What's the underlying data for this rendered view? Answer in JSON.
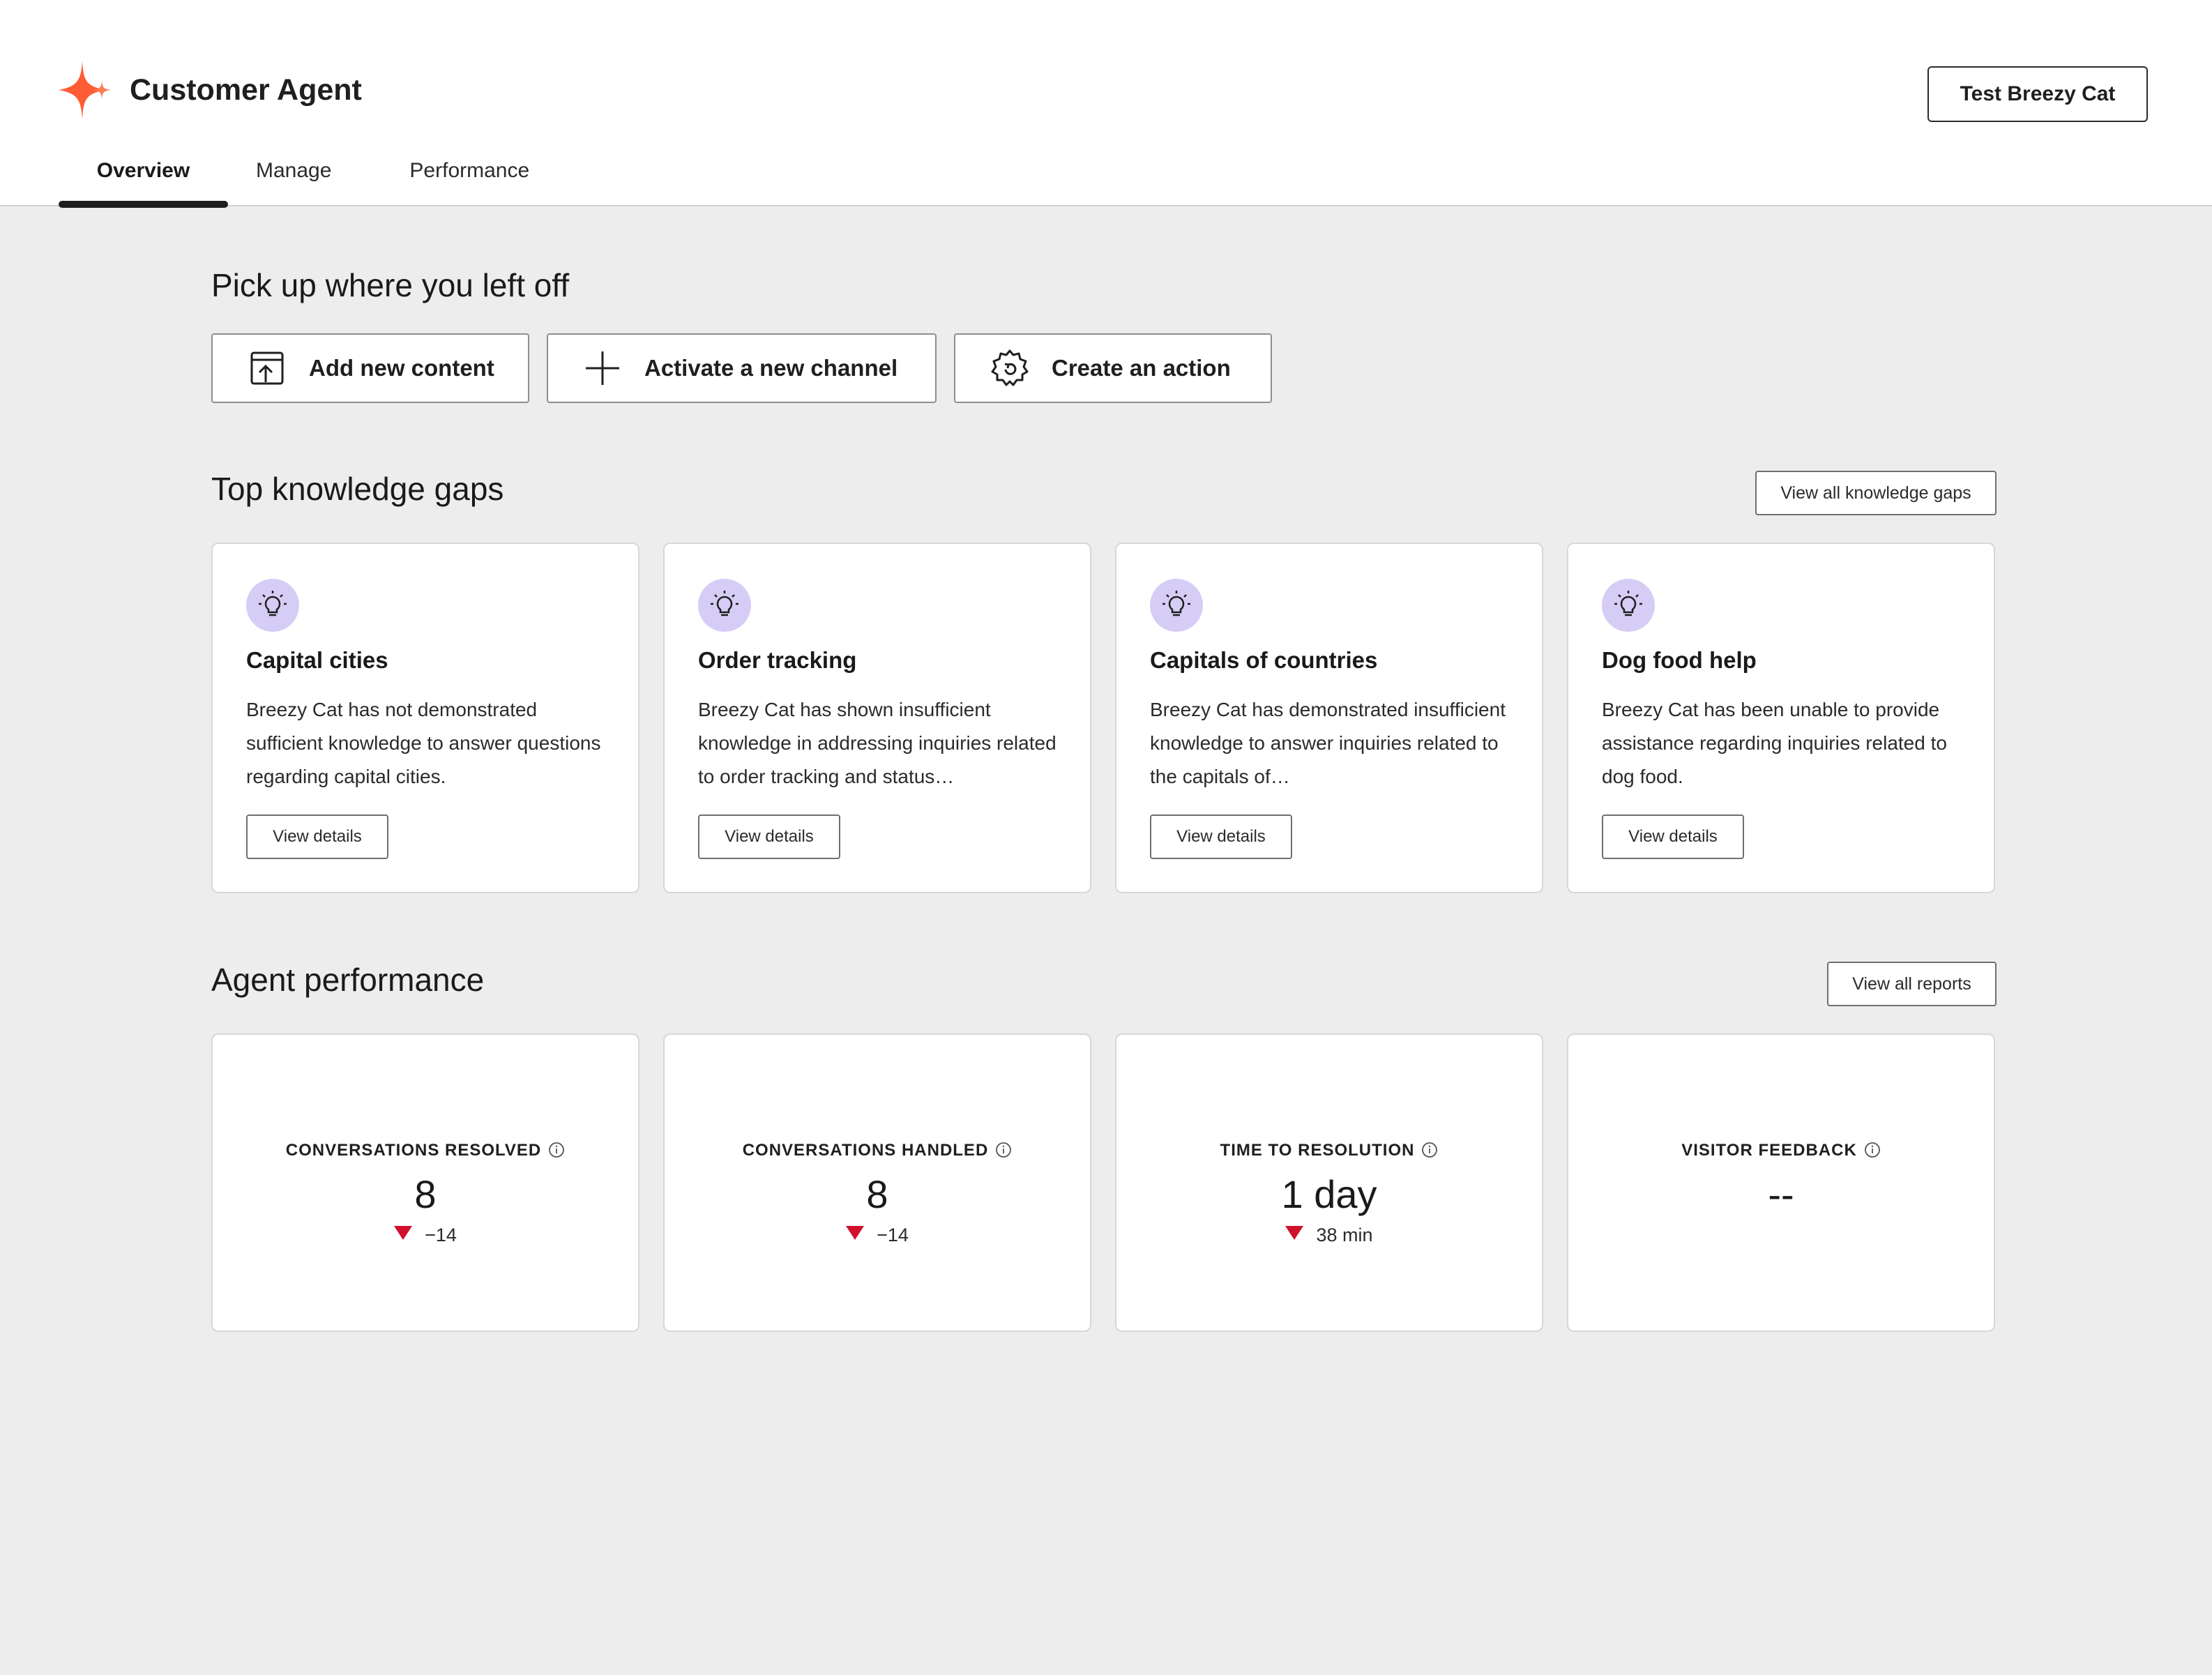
{
  "app": {
    "title": "Customer Agent",
    "test_button": "Test Breezy Cat"
  },
  "tabs": [
    {
      "label": "Overview",
      "active": true
    },
    {
      "label": "Manage",
      "active": false
    },
    {
      "label": "Performance",
      "active": false
    }
  ],
  "pickup": {
    "title": "Pick up where you left off",
    "actions": [
      {
        "label": "Add new content",
        "icon": "upload-content-icon"
      },
      {
        "label": "Activate a new channel",
        "icon": "plus-icon"
      },
      {
        "label": "Create an action",
        "icon": "gear-icon"
      }
    ]
  },
  "gaps": {
    "title": "Top knowledge gaps",
    "view_all": "View all knowledge gaps",
    "items": [
      {
        "title": "Capital cities",
        "description": "Breezy Cat has not demonstrated sufficient knowledge to answer questions regarding capital cities.",
        "button": "View details"
      },
      {
        "title": "Order tracking",
        "description": "Breezy Cat has shown insufficient knowledge in addressing inquiries related to order tracking and status…",
        "button": "View details"
      },
      {
        "title": "Capitals of countries",
        "description": "Breezy Cat has demonstrated insufficient knowledge to answer inquiries related to the capitals of…",
        "button": "View details"
      },
      {
        "title": "Dog food help",
        "description": "Breezy Cat has been unable to provide assistance regarding inquiries related to dog food.",
        "button": "View details"
      }
    ]
  },
  "performance": {
    "title": "Agent performance",
    "view_all": "View all reports",
    "metrics": [
      {
        "label": "CONVERSATIONS RESOLVED",
        "value": "8",
        "change": "−14",
        "trend": "down"
      },
      {
        "label": "CONVERSATIONS HANDLED",
        "value": "8",
        "change": "−14",
        "trend": "down"
      },
      {
        "label": "TIME TO RESOLUTION",
        "value": "1 day",
        "change": "38 min",
        "trend": "down"
      },
      {
        "label": "VISITOR FEEDBACK",
        "value": "--",
        "change": null,
        "trend": null
      }
    ]
  },
  "colors": {
    "brand": "#ff5c35",
    "bulb_bg": "#d6cdf6",
    "down_trend": "#d0112b",
    "page_bg": "#ededed"
  }
}
